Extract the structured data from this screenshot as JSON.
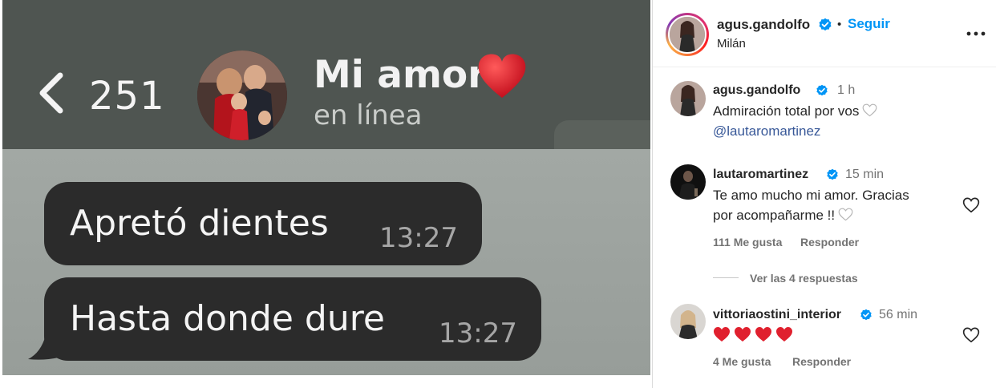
{
  "post_image": {
    "chat": {
      "unread_count": "251",
      "contact_name": "Mi amor",
      "contact_status": "en línea",
      "messages": [
        {
          "text": "Apretó dientes",
          "time": "13:27"
        },
        {
          "text": "Hasta donde dure",
          "time": "13:27"
        }
      ]
    }
  },
  "post": {
    "author": "agus.gandolfo",
    "separator": "•",
    "follow_label": "Seguir",
    "location": "Milán",
    "caption": {
      "username": "agus.gandolfo",
      "time": "1 h",
      "text": "Admiración total por vos",
      "mention": "@lautaromartinez"
    },
    "comments": [
      {
        "username": "lautaromartinez",
        "time": "15 min",
        "text_line1": "Te amo mucho mi amor. Gracias",
        "text_line2": "por acompañarme !!",
        "likes": "111 Me gusta",
        "reply_label": "Responder"
      },
      {
        "username": "vittoriaostini_interior",
        "time": "56 min",
        "hearts": "❤️❤️❤️❤️",
        "likes": "4 Me gusta",
        "reply_label": "Responder"
      }
    ],
    "view_replies": "Ver las 4 respuestas"
  },
  "colors": {
    "accent": "#0095f6",
    "verified": "#0095f6",
    "heart_red": "#e0202e",
    "chat_bubble": "#2b2b2b",
    "chat_header": "#4f5551"
  }
}
